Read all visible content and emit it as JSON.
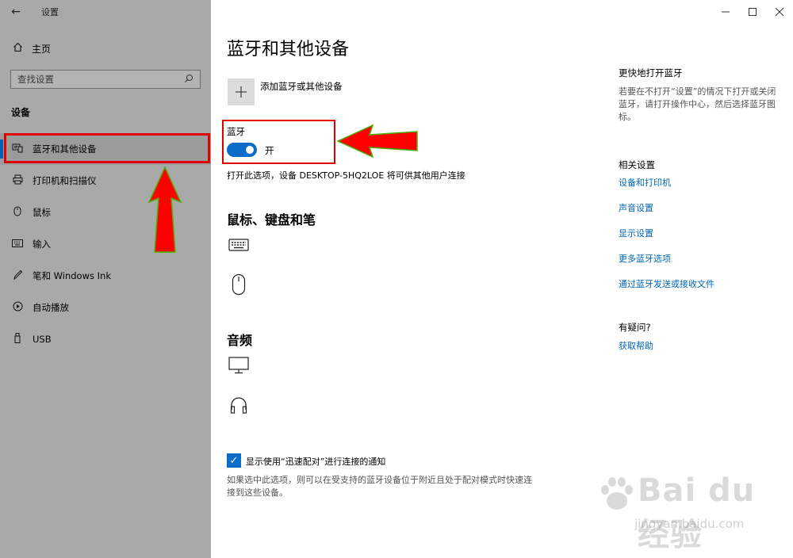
{
  "window": {
    "app_title": "设置",
    "back_icon": "back-arrow-icon",
    "controls": [
      "minimize-icon",
      "maximize-icon",
      "close-icon"
    ]
  },
  "sidebar": {
    "home_label": "主页",
    "search_placeholder": "查找设置",
    "section_title": "设备",
    "items": [
      {
        "label": "蓝牙和其他设备",
        "icon": "bluetooth-devices-icon",
        "active": true
      },
      {
        "label": "打印机和扫描仪",
        "icon": "printer-icon",
        "active": false
      },
      {
        "label": "鼠标",
        "icon": "mouse-icon",
        "active": false
      },
      {
        "label": "输入",
        "icon": "keyboard-icon",
        "active": false
      },
      {
        "label": "笔和 Windows Ink",
        "icon": "pen-icon",
        "active": false
      },
      {
        "label": "自动播放",
        "icon": "autoplay-icon",
        "active": false
      },
      {
        "label": "USB",
        "icon": "usb-icon",
        "active": false
      }
    ]
  },
  "main": {
    "title": "蓝牙和其他设备",
    "add_device_label": "添加蓝牙或其他设备",
    "bluetooth_label": "蓝牙",
    "bluetooth_state": "开",
    "bluetooth_on": true,
    "bluetooth_desc": "打开此选项，设备 DESKTOP-5HQ2LOE 将可供其他用户连接",
    "mouse_section": "鼠标、键盘和笔",
    "audio_section": "音频",
    "swift_pair_label": "显示使用“迅速配对”进行连接的通知",
    "swift_pair_checked": true,
    "swift_pair_desc": "如果选中此选项，则可以在受支持的蓝牙设备位于附近且处于配对模式时快速连接到这些设备。"
  },
  "right": {
    "quick_title": "更快地打开蓝牙",
    "quick_text": "若要在不打开“设置”的情况下打开或关闭蓝牙，请打开操作中心，然后选择蓝牙图标。",
    "related_title": "相关设置",
    "links": [
      "设备和打印机",
      "声音设置",
      "显示设置",
      "更多蓝牙选项",
      "通过蓝牙发送或接收文件"
    ],
    "help_title": "有疑问?",
    "help_link": "获取帮助"
  },
  "watermark": {
    "text": "Bai du 经验",
    "url": "jingyan.baidu.com"
  },
  "colors": {
    "accent": "#0a6ec9",
    "link": "#0066b4",
    "annotation": "#e00000",
    "arrow_fill": "#ff0000",
    "arrow_stroke": "#4caf00",
    "sidebar_bg": "#a9a9a9"
  }
}
